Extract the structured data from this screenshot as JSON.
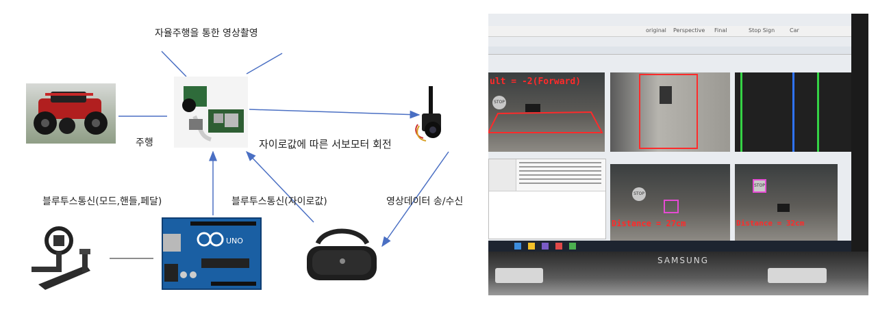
{
  "diagram": {
    "labels": {
      "filming": "자율주행을 통한 영상촬영",
      "drive": "주행",
      "servo": "자이로값에 따른 서보모터 회전",
      "bt_mode": "블루투스통신(모드,핸들,페달)",
      "bt_gyro": "블루투스통신(자이로값)",
      "video": "영상데이터 송/수신"
    },
    "nodes": [
      "rc-car",
      "camera-board",
      "fpv-camera",
      "steering-wheel",
      "arduino-uno",
      "vr-headset"
    ]
  },
  "photo": {
    "overlay_texts": {
      "result": "ult = -2(Forward)",
      "distance_left": "Distance = 27cm",
      "distance_right": "Distance = 32cm",
      "stop_left": "STOP",
      "stop_right": "STOP"
    },
    "window_tabs": [
      "original",
      "Perspective",
      "Final",
      "Stop Sign",
      "Car"
    ],
    "brand": "SAMSUNG",
    "arduino_board_text": "UNO"
  },
  "colors": {
    "arrow": "#4a6fc3",
    "overlay_red": "#ff2a2a",
    "arduino_blue": "#1a5fa3"
  }
}
